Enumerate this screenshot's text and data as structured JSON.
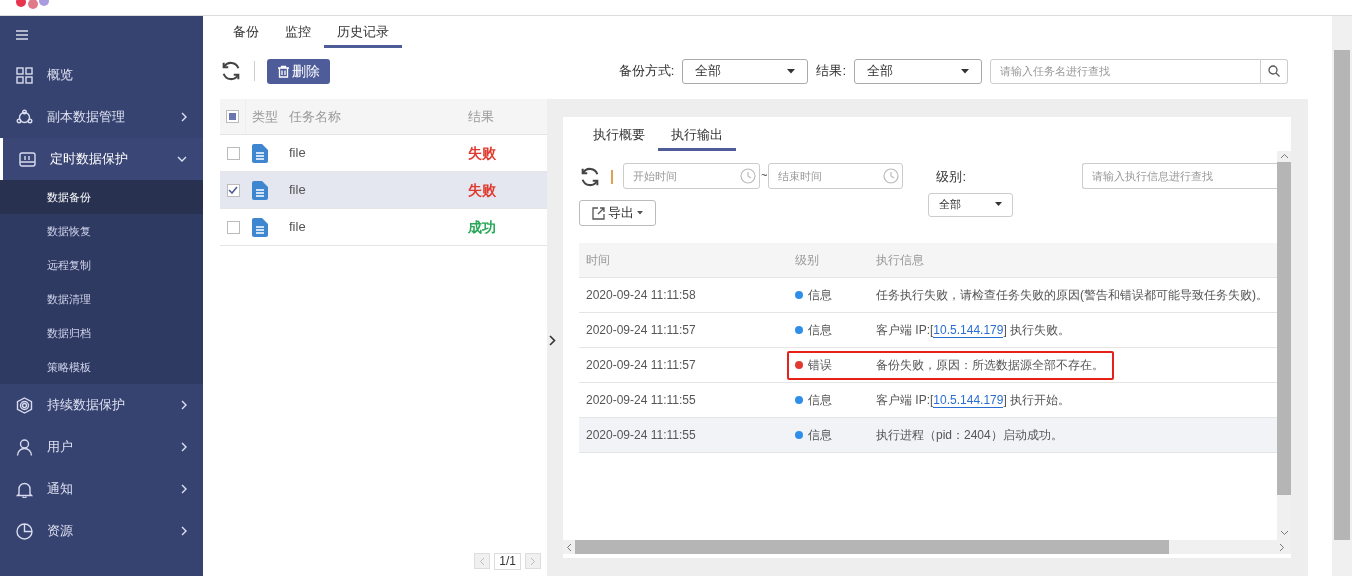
{
  "sidebar": {
    "items": [
      {
        "label": "概览",
        "expandable": false,
        "expanded": false
      },
      {
        "label": "副本数据管理",
        "expandable": true,
        "expanded": false
      },
      {
        "label": "定时数据保护",
        "expandable": true,
        "expanded": true,
        "children": [
          {
            "label": "数据备份",
            "selected": true
          },
          {
            "label": "数据恢复",
            "selected": false
          },
          {
            "label": "远程复制",
            "selected": false
          },
          {
            "label": "数据清理",
            "selected": false
          },
          {
            "label": "数据归档",
            "selected": false
          },
          {
            "label": "策略模板",
            "selected": false
          }
        ]
      },
      {
        "label": "持续数据保护",
        "expandable": true,
        "expanded": false
      },
      {
        "label": "用户",
        "expandable": true,
        "expanded": false
      },
      {
        "label": "通知",
        "expandable": true,
        "expanded": false
      },
      {
        "label": "资源",
        "expandable": true,
        "expanded": false
      }
    ]
  },
  "tabs": [
    {
      "label": "备份",
      "selected": false
    },
    {
      "label": "监控",
      "selected": false
    },
    {
      "label": "历史记录",
      "selected": true
    }
  ],
  "toolbar": {
    "delete_button": "删除",
    "filters": [
      {
        "label": "备份方式:",
        "value": "全部"
      },
      {
        "label": "结果:",
        "value": "全部"
      }
    ],
    "search": {
      "placeholder": "请输入任务名进行查找"
    }
  },
  "task_table": {
    "header_checkbox": {
      "indeterminate": true
    },
    "columns": [
      "类型",
      "任务名称",
      "结果"
    ],
    "rows": [
      {
        "name": "file",
        "result": "失败",
        "color": "#e03a2f",
        "checked": false,
        "selected": false
      },
      {
        "name": "file",
        "result": "失败",
        "color": "#e03a2f",
        "checked": true,
        "selected": true
      },
      {
        "name": "file",
        "result": "成功",
        "color": "#2aa85a",
        "checked": false,
        "selected": false
      }
    ]
  },
  "pager": {
    "page": "1/1"
  },
  "detail": {
    "tabs": [
      {
        "label": "执行概要",
        "selected": false
      },
      {
        "label": "执行输出",
        "selected": true
      }
    ],
    "start_time": {
      "placeholder": "开始时间"
    },
    "separator": "~",
    "end_time": {
      "placeholder": "结束时间"
    },
    "level_filter": {
      "label": "级别:",
      "value": "全部"
    },
    "search": {
      "placeholder": "请输入执行信息进行查找"
    },
    "export_button": "导出",
    "log_table": {
      "columns": [
        "时间",
        "级别",
        "执行信息"
      ],
      "rows": [
        {
          "time": "2020-09-24 11:11:58",
          "level": "信息",
          "kind": "info",
          "highlighted": false,
          "hovered": false,
          "message": [
            {
              "text": "任务执行失败，请检查任务失败的原因(警告和错误都可能导致任务失败)。"
            }
          ]
        },
        {
          "time": "2020-09-24 11:11:57",
          "level": "信息",
          "kind": "info",
          "highlighted": false,
          "hovered": false,
          "message": [
            {
              "text": "客户端 IP:["
            },
            {
              "link": "10.5.144.179"
            },
            {
              "text": "] 执行失败。"
            }
          ]
        },
        {
          "time": "2020-09-24 11:11:57",
          "level": "错误",
          "kind": "error",
          "highlighted": true,
          "hovered": false,
          "message": [
            {
              "text": "备份失败，原因：所选数据源全部不存在。"
            }
          ]
        },
        {
          "time": "2020-09-24 11:11:55",
          "level": "信息",
          "kind": "info",
          "highlighted": false,
          "hovered": false,
          "message": [
            {
              "text": "客户端 IP:["
            },
            {
              "link": "10.5.144.179"
            },
            {
              "text": "] 执行开始。"
            }
          ]
        },
        {
          "time": "2020-09-24 11:11:55",
          "level": "信息",
          "kind": "info",
          "highlighted": false,
          "hovered": true,
          "message": [
            {
              "text": "执行进程（pid：2404）启动成功。"
            }
          ]
        }
      ]
    }
  }
}
